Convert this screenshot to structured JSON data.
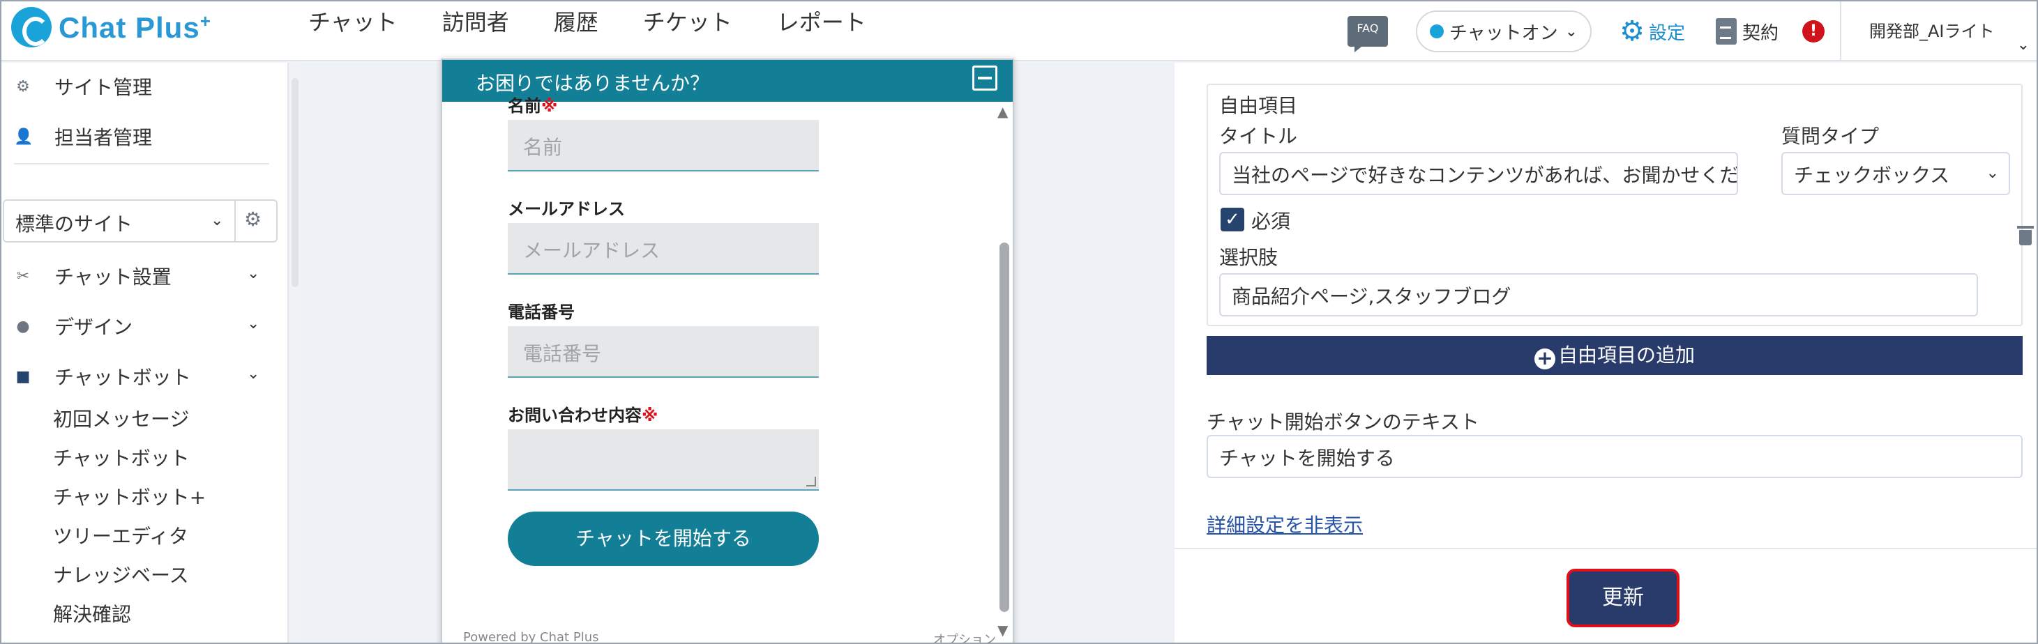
{
  "header": {
    "logo_text": "Chat Plus",
    "logo_sup": "+",
    "nav": [
      "チャット",
      "訪問者",
      "履歴",
      "チケット",
      "レポート"
    ],
    "faq_label": "FAQ",
    "chat_status": "チャットオン",
    "settings_label": "設定",
    "contract_label": "契約",
    "alert_label": "!",
    "user_name": "開発部_AIライト"
  },
  "sidebar": {
    "top_items": [
      "サイト管理",
      "担当者管理"
    ],
    "site_select_value": "標準のサイト",
    "sections": [
      "チャット設置",
      "デザイン",
      "チャットボット"
    ],
    "sub_items": [
      "初回メッセージ",
      "チャットボット",
      "チャットボット+",
      "ツリーエディタ",
      "ナレッジベース",
      "解決確認"
    ]
  },
  "widget": {
    "header_title": "お困りではありませんか？",
    "fields": [
      {
        "label": "名前",
        "required": true,
        "placeholder": "名前"
      },
      {
        "label": "メールアドレス",
        "required": false,
        "placeholder": "メールアドレス"
      },
      {
        "label": "電話番号",
        "required": false,
        "placeholder": "電話番号"
      },
      {
        "label": "お問い合わせ内容",
        "required": true,
        "placeholder": ""
      }
    ],
    "required_mark": "※",
    "start_button": "チャットを開始する",
    "powered_by": "Powered by Chat Plus",
    "option_label": "オプション"
  },
  "panel": {
    "custom_item_heading": "自由項目",
    "title_label": "タイトル",
    "title_value": "当社のページで好きなコンテンツがあれば、お聞かせください",
    "question_type_label": "質問タイプ",
    "question_type_value": "チェックボックス",
    "required_label": "必須",
    "required_checked": true,
    "choices_label": "選択肢",
    "choices_value": "商品紹介ページ,スタッフブログ",
    "add_item_button": "自由項目の追加",
    "start_button_text_label": "チャット開始ボタンのテキスト",
    "start_button_text_value": "チャットを開始する",
    "hide_details_link": "詳細設定を非表示",
    "update_button": "更新"
  },
  "colors": {
    "brand": "#1aa3d9",
    "widget_header": "#137f96",
    "primary_button": "#283b6b",
    "required_red": "#d9121b",
    "highlight_border": "#e0101b"
  }
}
